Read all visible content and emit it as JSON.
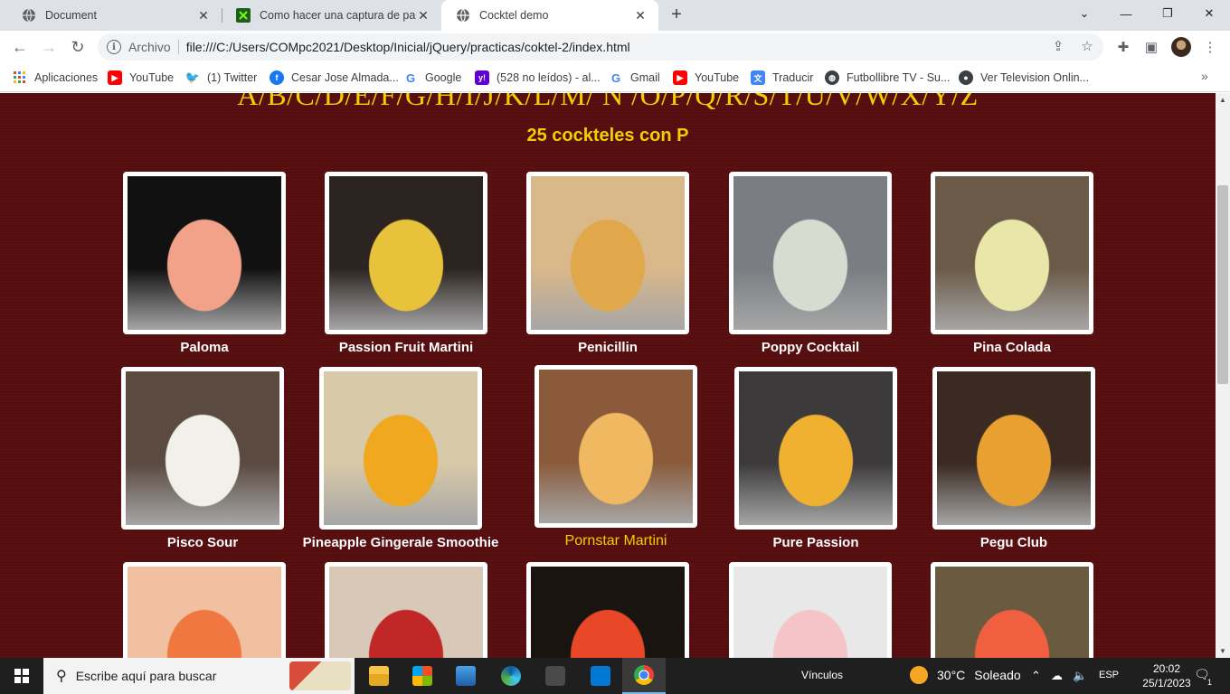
{
  "browser": {
    "tabs": [
      {
        "title": "Document",
        "icon": "globe-icon"
      },
      {
        "title": "Como hacer una captura de pant",
        "icon": "app-icon"
      },
      {
        "title": "Cocktel demo",
        "icon": "globe-icon"
      }
    ],
    "active_tab": 2,
    "new_tab_symbol": "+",
    "address": {
      "scheme": "Archivo",
      "url": "file:///C:/Users/COMpc2021/Desktop/Inicial/jQuery/practicas/coktel-2/index.html"
    }
  },
  "bookmarks": [
    {
      "label": "Aplicaciones",
      "icon": "apps-grid-icon",
      "color": "#ea4335"
    },
    {
      "label": "YouTube",
      "icon": "youtube-icon",
      "color": "#ff0000"
    },
    {
      "label": "(1) Twitter",
      "icon": "twitter-icon",
      "color": "#1d9bf0"
    },
    {
      "label": "Cesar Jose Almada...",
      "icon": "facebook-icon",
      "color": "#1877f2"
    },
    {
      "label": "Google",
      "icon": "google-icon",
      "color": "#4285f4"
    },
    {
      "label": "(528 no leídos) - al...",
      "icon": "yahoo-icon",
      "color": "#6001d2"
    },
    {
      "label": "Gmail",
      "icon": "google-icon",
      "color": "#4285f4"
    },
    {
      "label": "YouTube",
      "icon": "youtube-icon",
      "color": "#ff0000"
    },
    {
      "label": "Traducir",
      "icon": "translate-icon",
      "color": "#4285f4"
    },
    {
      "label": "Futbollibre TV - Su...",
      "icon": "globe-icon",
      "color": "#3c4043"
    },
    {
      "label": "Ver Television Onlin...",
      "icon": "tv-icon",
      "color": "#3c4043"
    }
  ],
  "page": {
    "alphabet": "A/B/C/D/E/F/G/H/I/J/K/L/M/ N /O/P/Q/R/S/T/U/V/W/X/Y/Z",
    "heading": "25 cockteles con P",
    "accent_color": "#f0d000",
    "background_color": "#5a0f10",
    "cocktails": [
      {
        "name": "Paloma",
        "colors": [
          "#111111",
          "#f3a28a"
        ]
      },
      {
        "name": "Passion Fruit Martini",
        "colors": [
          "#2b2420",
          "#e8c23a"
        ]
      },
      {
        "name": "Penicillin",
        "colors": [
          "#d9b88a",
          "#e0a84a"
        ]
      },
      {
        "name": "Poppy Cocktail",
        "colors": [
          "#7a7e82",
          "#d8dcd0"
        ]
      },
      {
        "name": "Pina Colada",
        "colors": [
          "#6b5a48",
          "#e8e6a8"
        ]
      },
      {
        "name": "Pisco Sour",
        "colors": [
          "#5a4a40",
          "#f2f0ea"
        ]
      },
      {
        "name": "Pineapple Gingerale Smoothie",
        "colors": [
          "#d8c9a8",
          "#f0a820"
        ]
      },
      {
        "name": "Pornstar Martini",
        "colors": [
          "#8a5a3a",
          "#f0b860"
        ]
      },
      {
        "name": "Pure Passion",
        "colors": [
          "#3c3a3a",
          "#f0b030"
        ]
      },
      {
        "name": "Pegu Club",
        "colors": [
          "#3a2a22",
          "#e8a030"
        ]
      },
      {
        "name": "",
        "colors": [
          "#f0c0a0",
          "#f07840"
        ]
      },
      {
        "name": "",
        "colors": [
          "#d8c8b8",
          "#c02828"
        ]
      },
      {
        "name": "",
        "colors": [
          "#1a1410",
          "#e84828"
        ]
      },
      {
        "name": "",
        "colors": [
          "#e8e8e8",
          "#f4c4c8"
        ]
      },
      {
        "name": "",
        "colors": [
          "#6a5a40",
          "#f06040"
        ]
      }
    ],
    "hovered_cocktail": "Pornstar Martini"
  },
  "taskbar": {
    "search_placeholder": "Escribe aquí para buscar",
    "vinculos": "Vínculos",
    "weather": {
      "temp": "30°C",
      "condition": "Soleado"
    },
    "lang": "ESP",
    "time": "20:02",
    "date": "25/1/2023",
    "notifications": "1"
  }
}
